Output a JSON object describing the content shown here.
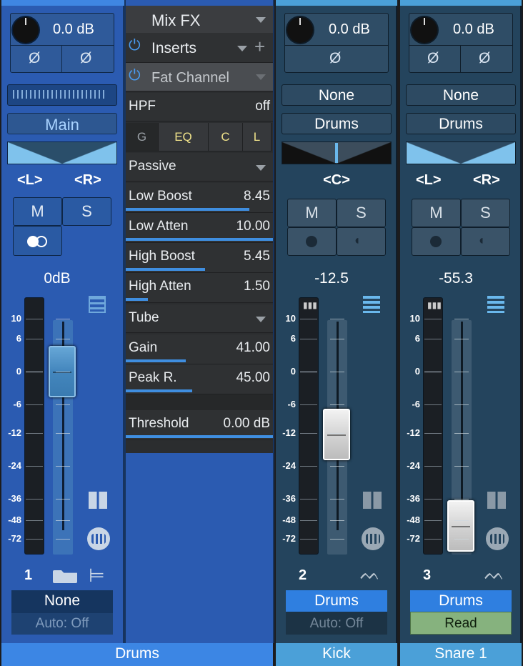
{
  "colors": {
    "blue_strip": "#2a5cb4",
    "teal_strip": "#24455e",
    "accent": "#3c8fe8",
    "kick_header": "#4ba0d8",
    "read_green": "#86b27e"
  },
  "drums": {
    "gain": "0.0 dB",
    "phase1": "Ø",
    "phase2": "Ø",
    "output": "Main",
    "pan_left": "<L>",
    "pan_right": "<R>",
    "mute": "M",
    "solo": "S",
    "volume": "0dB",
    "number": "1",
    "input": "None",
    "auto": "Auto: Off",
    "name": "Drums",
    "fader_level_db": 0
  },
  "fx": {
    "title": "Mix FX",
    "inserts": "Inserts",
    "plugin": "Fat Channel",
    "hpf_label": "HPF",
    "hpf_value": "off",
    "tabs": [
      "G",
      "EQ",
      "C",
      "L"
    ],
    "eq_mode": "Passive",
    "eq_params": [
      {
        "label": "Low Boost",
        "value": "8.45",
        "fill": 0.84
      },
      {
        "label": "Low Atten",
        "value": "10.00",
        "fill": 1.0
      },
      {
        "label": "High Boost",
        "value": "5.45",
        "fill": 0.54
      },
      {
        "label": "High Atten",
        "value": "1.50",
        "fill": 0.15
      }
    ],
    "comp_mode": "Tube",
    "comp_params": [
      {
        "label": "Gain",
        "value": "41.00",
        "fill": 0.41
      },
      {
        "label": "Peak R.",
        "value": "45.00",
        "fill": 0.45
      }
    ],
    "threshold_label": "Threshold",
    "threshold_value": "0.00 dB",
    "threshold_fill": 1.0
  },
  "kick": {
    "gain": "0.0 dB",
    "phase": "Ø",
    "input": "None",
    "output": "Drums",
    "pan": "<C>",
    "mute": "M",
    "solo": "S",
    "volume": "-12.5",
    "number": "2",
    "out_bottom": "Drums",
    "auto": "Auto: Off",
    "name": "Kick",
    "fader_level_db": -12.5
  },
  "snare": {
    "gain": "0.0 dB",
    "phase1": "Ø",
    "phase2": "Ø",
    "input": "None",
    "output": "Drums",
    "pan_left": "<L>",
    "pan_right": "<R>",
    "mute": "M",
    "solo": "S",
    "volume": "-55.3",
    "number": "3",
    "out_bottom": "Drums",
    "auto": "Read",
    "name": "Snare 1",
    "fader_level_db": -55.3
  },
  "scale": [
    "10",
    "6",
    "0",
    "-6",
    "-12",
    "-24",
    "-36",
    "-48",
    "-72"
  ]
}
